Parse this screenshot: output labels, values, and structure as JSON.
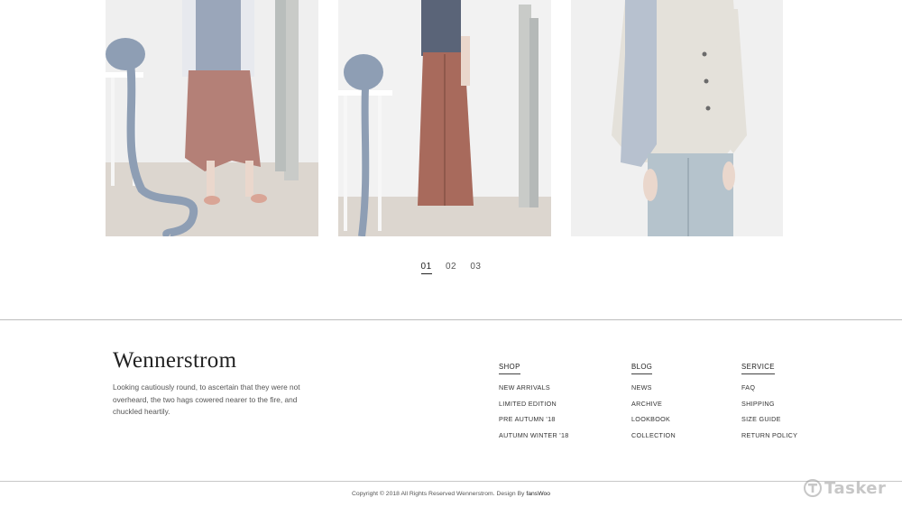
{
  "products": [
    {
      "id": "p1",
      "image": "model in pink asymmetric skirt with chunky knit scarf"
    },
    {
      "id": "p2",
      "image": "model in navy shirt and rust pleated wide trousers"
    },
    {
      "id": "p3",
      "image": "model in cream cropped jacket and light blue trousers"
    }
  ],
  "pagination": {
    "pages": [
      "01",
      "02",
      "03"
    ],
    "active": "01"
  },
  "footer": {
    "brand": "Wennerstrom",
    "tagline": "Looking cautiously round, to ascertain that they were not overheard, the two hags cowered nearer to the fire, and chuckled heartily.",
    "columns": {
      "shop": {
        "heading": "SHOP",
        "links": [
          "NEW ARRIVALS",
          "LIMITED EDITION",
          "PRE AUTUMN '18",
          "AUTUMN WINTER '18"
        ]
      },
      "blog": {
        "heading": "BLOG",
        "links": [
          "NEWS",
          "ARCHIVE",
          "LOOKBOOK",
          "COLLECTION"
        ]
      },
      "service": {
        "heading": "SERVICE",
        "links": [
          "FAQ",
          "SHIPPING",
          "SIZE GUIDE",
          "RETURN POLICY"
        ]
      }
    },
    "copyright": "Copyright © 2018 All Rights Reserved Wennerstrom.  Design By",
    "designer": "fansWoo"
  },
  "watermark": "Tasker",
  "colors": {
    "skirt_pink": "#b48077",
    "trouser_rust": "#a86a5c",
    "knit_blue": "#8e9eb4",
    "shirt_navy": "#5a6478",
    "jacket_cream": "#e4e1da",
    "pants_lightblue": "#b5c3cc"
  }
}
